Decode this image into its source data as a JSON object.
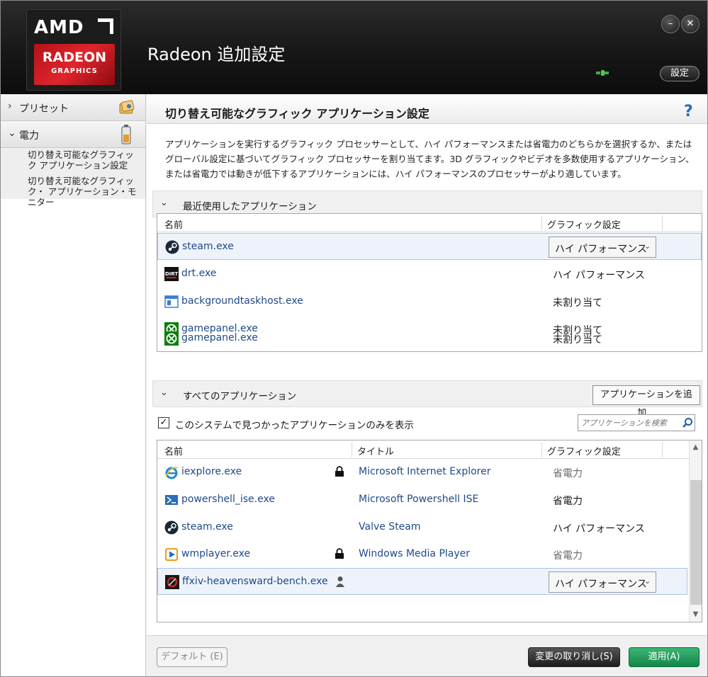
{
  "header": {
    "logo": {
      "brand": "AMD",
      "product": "RADEON",
      "sub": "GRAPHICS"
    },
    "title": "Radeon 追加設定",
    "minimize_label": "–",
    "close_label": "✕",
    "settings_label": "設定"
  },
  "sidebar": {
    "preset_label": "プリセット",
    "power_label": "電力",
    "sub_items": [
      {
        "label": "切り替え可能なグラフィック アプリケーション設定"
      },
      {
        "label": "切り替え可能なグラフィック・ アプリケーション・モニター"
      }
    ]
  },
  "main": {
    "page_title": "切り替え可能なグラフィック アプリケーション設定",
    "help": "?",
    "description": "アプリケーションを実行するグラフィック プロセッサーとして、ハイ パフォーマンスまたは省電力のどちらかを選択するか、またはグローバル設定に基づいてグラフィック プロセッサーを割り当てます。3D グラフィックやビデオを多数使用するアプリケーション、または省電力では動きが低下するアプリケーションには、ハイ パフォーマンスのプロセッサーがより適しています。",
    "recent": {
      "section_label": "最近使用したアプリケーション",
      "columns": {
        "name": "名前",
        "setting": "グラフィック設定"
      },
      "rows": [
        {
          "name": "steam.exe",
          "setting": "ハイ パフォーマンス",
          "icon": "steam-icon"
        },
        {
          "name": "drt.exe",
          "setting": "ハイ パフォーマンス",
          "icon": "dirt-icon"
        },
        {
          "name": "backgroundtaskhost.exe",
          "setting": "未割り当て",
          "icon": "window-icon"
        },
        {
          "name": "gamepanel.exe",
          "setting": "未割り当て",
          "icon": "xbox-icon"
        },
        {
          "name": "gamepanel.exe",
          "setting": "未割り当て",
          "icon": "xbox-icon"
        }
      ]
    },
    "all": {
      "section_label": "すべてのアプリケーション",
      "add_button": "アプリケーションを追加...",
      "filter_label": "このシステムで見つかったアプリケーションのみを表示",
      "filter_checked": true,
      "search_placeholder": "アプリケーションを検索",
      "columns": {
        "name": "名前",
        "title": "タイトル",
        "setting": "グラフィック設定"
      },
      "rows": [
        {
          "name": "iexplore.exe",
          "title": "Microsoft Internet Explorer",
          "setting": "省電力",
          "icon": "ie-icon",
          "locked": true
        },
        {
          "name": "powershell_ise.exe",
          "title": "Microsoft Powershell ISE",
          "setting": "省電力",
          "icon": "powershell-icon",
          "locked": false
        },
        {
          "name": "steam.exe",
          "title": "Valve Steam",
          "setting": "ハイ パフォーマンス",
          "icon": "steam-icon",
          "locked": false
        },
        {
          "name": "wmplayer.exe",
          "title": "Windows Media Player",
          "setting": "省電力",
          "icon": "wmp-icon",
          "locked": true
        },
        {
          "name": "ffxiv-heavensward-bench.exe",
          "title": "",
          "setting": "ハイ パフォーマンス",
          "icon": "ffxiv-icon",
          "user": true
        }
      ]
    }
  },
  "footer": {
    "default_label": "デフォルト (E)",
    "discard_label": "変更の取り消し(S)",
    "apply_label": "適用(A)"
  },
  "colors": {
    "accent_green": "#1f9a5a",
    "link_blue": "#1f4a8a",
    "header_dark": "#161616",
    "brand_red": "#e1252c"
  }
}
